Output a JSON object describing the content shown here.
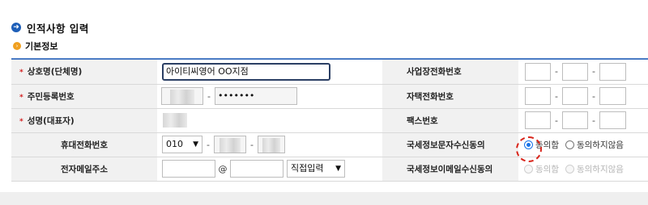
{
  "section": {
    "title": "인적사항 입력",
    "icon": "arrow-right-circle-icon"
  },
  "subsection": {
    "title": "기본정보",
    "icon": "orange-circle-icon"
  },
  "colors": {
    "accent": "#1e5fb8",
    "required": "#d32020",
    "radio_selected": "#1a73e8",
    "highlight_ring": "#d9261c"
  },
  "left": {
    "business_name": {
      "label": "상호명(단체명)",
      "required_mark": "*",
      "value": "아이티씨영어 OO지점"
    },
    "resident_number": {
      "label": "주민등록번호",
      "required_mark": "*",
      "separator": "-",
      "back_masked": "•••••••"
    },
    "representative": {
      "label": "성명(대표자)",
      "required_mark": "*"
    },
    "mobile": {
      "label": "휴대전화번호",
      "prefix": "010",
      "options": [
        "010"
      ],
      "separator": "-"
    },
    "email": {
      "label": "전자메일주소",
      "at": "@",
      "domain_select": "직접입력"
    }
  },
  "right": {
    "business_phone": {
      "label": "사업장전화번호",
      "separator": "-"
    },
    "home_phone": {
      "label": "자택전화번호",
      "separator": "-"
    },
    "fax": {
      "label": "팩스번호",
      "separator": "-"
    },
    "sms_consent": {
      "label": "국세정보문자수신동의",
      "agree": "동의함",
      "disagree": "동의하지않음",
      "selected": "agree"
    },
    "email_consent": {
      "label": "국세정보이메일수신동의",
      "agree": "동의함",
      "disagree": "동의하지않음",
      "disabled": true
    }
  }
}
